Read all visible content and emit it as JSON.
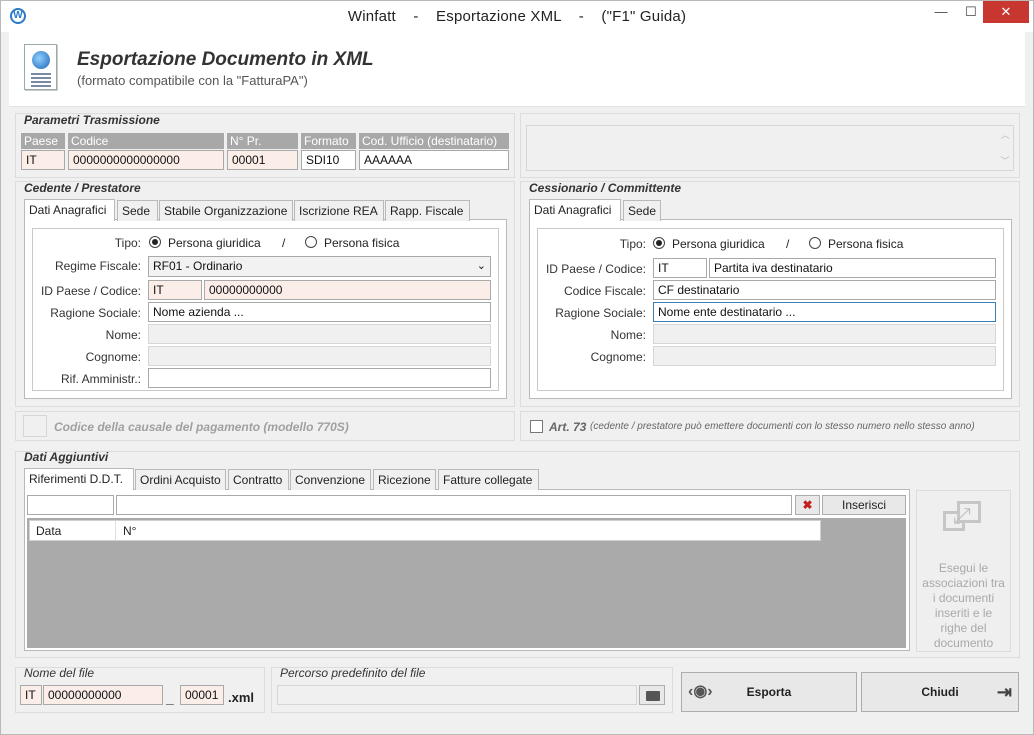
{
  "window": {
    "title": "Winfatt    -    Esportazione XML    -    (\"F1\" Guida)",
    "app_icon": "W",
    "minimize": "—",
    "maximize": "☐",
    "close": "✕"
  },
  "header": {
    "title": "Esportazione Documento in XML",
    "subtitle": "(formato compatibile con la \"FatturaPA\")"
  },
  "trasmissione": {
    "section": "Parametri Trasmissione",
    "col_paese": "Paese",
    "col_codice": "Codice",
    "col_npr": "N° Pr.",
    "col_formato": "Formato",
    "col_ufficio": "Cod. Ufficio (destinatario)",
    "paese": "IT",
    "codice": "0000000000000000",
    "npr": "00001",
    "formato": "SDI10",
    "ufficio": "AAAAAA"
  },
  "cedente": {
    "section": "Cedente / Prestatore",
    "tabs": [
      "Dati Anagrafici",
      "Sede",
      "Stabile Organizzazione",
      "Iscrizione REA",
      "Rapp. Fiscale"
    ],
    "tipo_label": "Tipo:",
    "giuridica": "Persona giuridica",
    "sep": "/",
    "fisica": "Persona fisica",
    "regime_label": "Regime Fiscale:",
    "regime_value": "RF01 - Ordinario",
    "id_label": "ID Paese / Codice:",
    "id_paese": "IT",
    "id_codice": "00000000000",
    "ragione_label": "Ragione Sociale:",
    "ragione_value": "Nome azienda ...",
    "nome_label": "Nome:",
    "cognome_label": "Cognome:",
    "rif_label": "Rif. Amministr.:"
  },
  "cessionario": {
    "section": "Cessionario / Committente",
    "tabs": [
      "Dati Anagrafici",
      "Sede"
    ],
    "tipo_label": "Tipo:",
    "giuridica": "Persona giuridica",
    "sep": "/",
    "fisica": "Persona fisica",
    "id_label": "ID Paese / Codice:",
    "id_paese": "IT",
    "id_codice": "Partita iva destinatario",
    "cf_label": "Codice Fiscale:",
    "cf_value": "CF destinatario",
    "ragione_label": "Ragione Sociale:",
    "ragione_value": "Nome ente destinatario ...",
    "nome_label": "Nome:",
    "cognome_label": "Cognome:"
  },
  "causale": {
    "label": "Codice della causale del pagamento (modello 770S)"
  },
  "art73": {
    "label": "Art. 73",
    "note": "(cedente / prestatore può emettere documenti con lo stesso numero nello stesso anno)"
  },
  "aggiuntivi": {
    "section": "Dati Aggiuntivi",
    "tabs": [
      "Riferimenti D.D.T.",
      "Ordini Acquisto",
      "Contratto",
      "Convenzione",
      "Ricezione",
      "Fatture collegate"
    ],
    "inserisci": "Inserisci",
    "col_data": "Data",
    "col_n": "N°",
    "esegui": "Esegui le associazioni tra i documenti inseriti e le righe del documento"
  },
  "file": {
    "section": "Nome del file",
    "paese": "IT",
    "codice": "00000000000",
    "sep": "_",
    "progr": "00001",
    "ext": ".xml"
  },
  "percorso": {
    "section": "Percorso predefinito del file"
  },
  "actions": {
    "esporta": "Esporta",
    "chiudi": "Chiudi"
  },
  "colors": {
    "pink_field": "#fbeee9",
    "close_red": "#c7372f",
    "column_header": "#a8a8a8"
  }
}
